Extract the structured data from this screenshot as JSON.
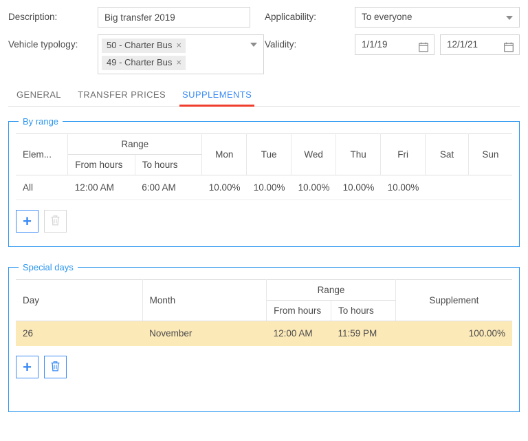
{
  "form": {
    "description": {
      "label": "Description:",
      "value": "Big transfer 2019",
      "placeholder": ""
    },
    "vehicle_typology": {
      "label": "Vehicle typology:",
      "chips": [
        {
          "text": "50 - Charter Bus",
          "remove": "×"
        },
        {
          "text": "49 - Charter Bus",
          "remove": "×"
        }
      ]
    },
    "applicability": {
      "label": "Applicability:",
      "value": "To everyone"
    },
    "validity": {
      "label": "Validity:",
      "from": "1/1/19",
      "to": "12/1/21"
    }
  },
  "tabs": [
    {
      "label": "GENERAL",
      "active": false
    },
    {
      "label": "TRANSFER PRICES",
      "active": false
    },
    {
      "label": "SUPPLEMENTS",
      "active": true
    }
  ],
  "by_range": {
    "legend": "By range",
    "headers": {
      "element": "Elem...",
      "range": "Range",
      "from_hours": "From hours",
      "to_hours": "To hours",
      "days": [
        "Mon",
        "Tue",
        "Wed",
        "Thu",
        "Fri",
        "Sat",
        "Sun"
      ]
    },
    "rows": [
      {
        "element": "All",
        "from_hours": "12:00 AM",
        "to_hours": "6:00 AM",
        "mon": "10.00%",
        "tue": "10.00%",
        "wed": "10.00%",
        "thu": "10.00%",
        "fri": "10.00%",
        "sat": "",
        "sun": ""
      }
    ],
    "add_button": {
      "name": "add",
      "glyph": "+",
      "enabled": true
    },
    "delete_button": {
      "name": "delete",
      "glyph": "trash",
      "enabled": false
    }
  },
  "special_days": {
    "legend": "Special days",
    "headers": {
      "day": "Day",
      "month": "Month",
      "range": "Range",
      "from_hours": "From hours",
      "to_hours": "To hours",
      "supplement": "Supplement"
    },
    "rows": [
      {
        "day": "26",
        "month": "November",
        "from_hours": "12:00 AM",
        "to_hours": "11:59 PM",
        "supplement": "100.00%",
        "selected": true
      }
    ],
    "add_button": {
      "name": "add",
      "glyph": "+",
      "enabled": true
    },
    "delete_button": {
      "name": "delete",
      "glyph": "trash",
      "enabled": true
    }
  },
  "colors": {
    "accent_blue": "#2b96f1",
    "tab_active_text": "#3b8bf5",
    "tab_underline_red": "#f03d2d",
    "row_highlight": "#fce9b8",
    "chip_bg": "#ececec",
    "border_gray": "#d3d3d3"
  }
}
